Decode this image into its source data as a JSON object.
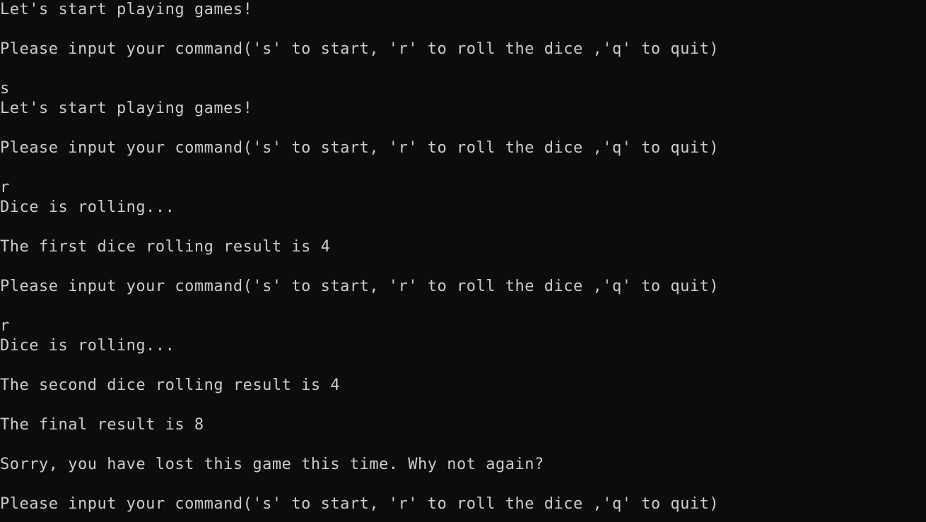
{
  "console": {
    "background": "#0c0c0c",
    "foreground": "#cccccc",
    "lines": [
      "Let's start playing games!",
      "Please input your command('s' to start, 'r' to roll the dice ,'q' to quit)",
      "s",
      "Let's start playing games!",
      "Please input your command('s' to start, 'r' to roll the dice ,'q' to quit)",
      "r",
      "Dice is rolling...",
      "The first dice rolling result is 4",
      "Please input your command('s' to start, 'r' to roll the dice ,'q' to quit)",
      "r",
      "Dice is rolling...",
      "The second dice rolling result is 4",
      "The final result is 8",
      "Sorry, you have lost this game this time. Why not again?",
      "Please input your command('s' to start, 'r' to roll the dice ,'q' to quit)"
    ]
  }
}
